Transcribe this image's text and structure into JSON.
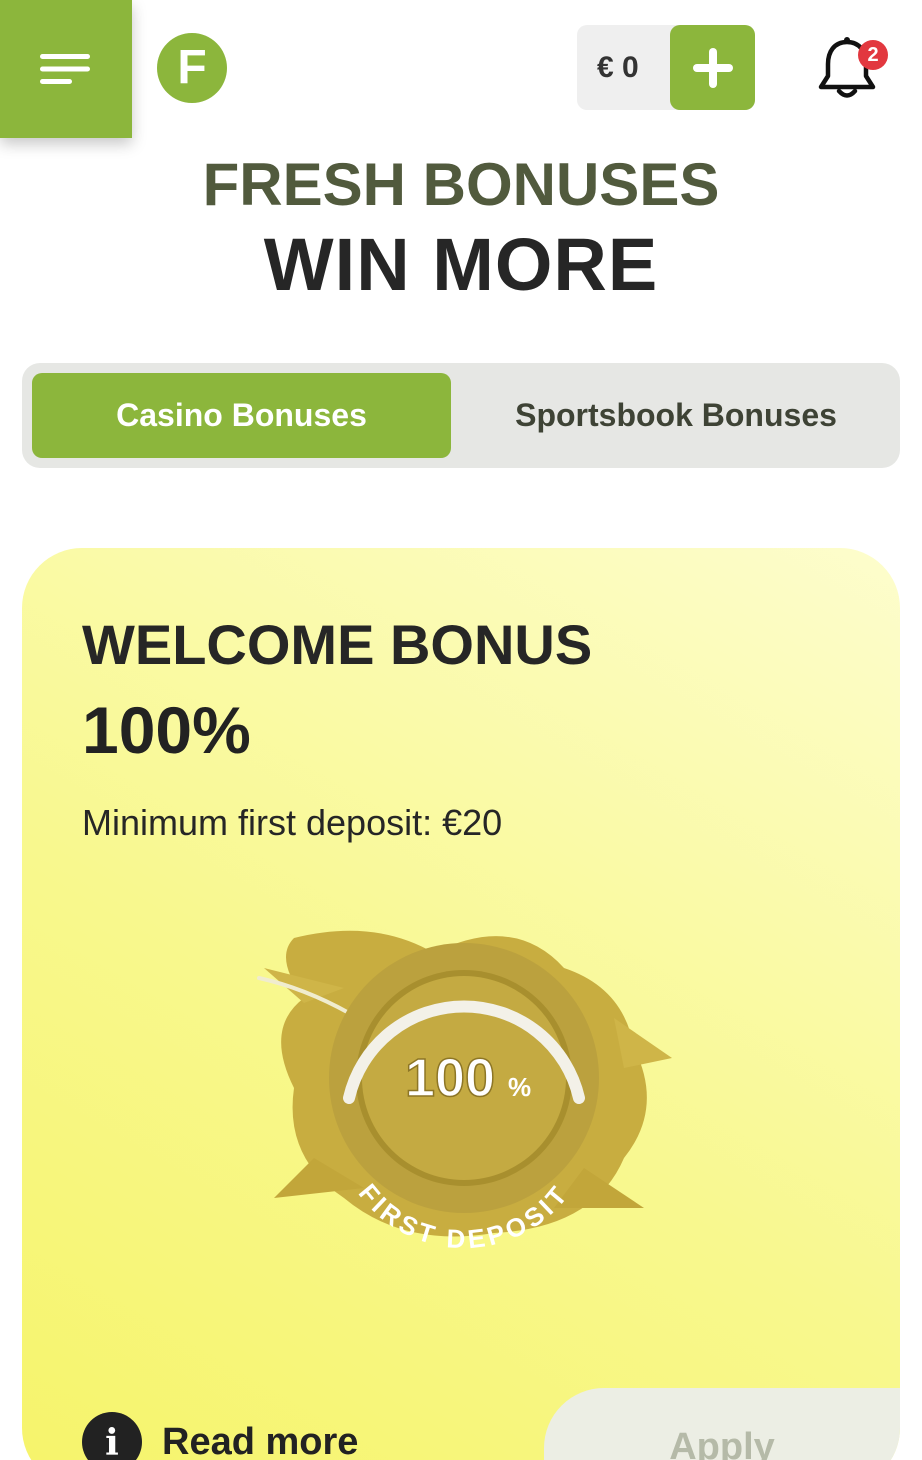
{
  "header": {
    "menu_icon": "hamburger-menu-icon",
    "logo_letter": "F",
    "balance": "€ 0",
    "deposit_icon": "plus-icon",
    "bell_icon": "bell-icon",
    "notification_count": "2"
  },
  "hero": {
    "subtitle": "FRESH BONUSES",
    "title": "WIN MORE"
  },
  "tabs": [
    {
      "label": "Casino Bonuses",
      "active": true
    },
    {
      "label": "Sportsbook Bonuses",
      "active": false
    }
  ],
  "bonus_card": {
    "title": "WELCOME BONUS",
    "percent": "100%",
    "description": "Minimum first deposit: €20",
    "badge_value": "100",
    "badge_unit": "%",
    "badge_caption": "FIRST DEPOSIT",
    "read_more_label": "Read more",
    "apply_label": "Apply"
  },
  "colors": {
    "accent": "#8cb63c",
    "badge_gold": "#c8ad40",
    "notification": "#e2383f",
    "heading_dark": "#262626",
    "heading_olive": "#515a3d"
  }
}
